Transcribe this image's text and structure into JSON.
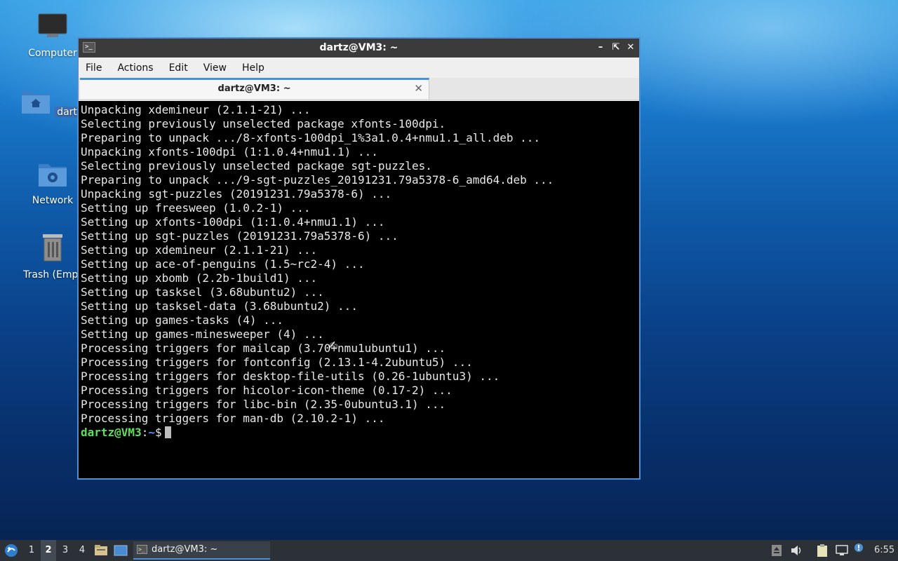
{
  "desktop": {
    "icons": [
      {
        "label": "Computer"
      },
      {
        "label": "dartz"
      },
      {
        "label": "Network"
      },
      {
        "label": "Trash (Empt"
      }
    ]
  },
  "window": {
    "title": "dartz@VM3: ~",
    "menu": [
      "File",
      "Actions",
      "Edit",
      "View",
      "Help"
    ],
    "tab_title": "dartz@VM3: ~",
    "terminal_lines": [
      "Unpacking xdemineur (2.1.1-21) ...",
      "Selecting previously unselected package xfonts-100dpi.",
      "Preparing to unpack .../8-xfonts-100dpi_1%3a1.0.4+nmu1.1_all.deb ...",
      "Unpacking xfonts-100dpi (1:1.0.4+nmu1.1) ...",
      "Selecting previously unselected package sgt-puzzles.",
      "Preparing to unpack .../9-sgt-puzzles_20191231.79a5378-6_amd64.deb ...",
      "Unpacking sgt-puzzles (20191231.79a5378-6) ...",
      "Setting up freesweep (1.0.2-1) ...",
      "Setting up xfonts-100dpi (1:1.0.4+nmu1.1) ...",
      "Setting up sgt-puzzles (20191231.79a5378-6) ...",
      "Setting up xdemineur (2.1.1-21) ...",
      "Setting up ace-of-penguins (1.5~rc2-4) ...",
      "Setting up xbomb (2.2b-1build1) ...",
      "Setting up tasksel (3.68ubuntu2) ...",
      "Setting up tasksel-data (3.68ubuntu2) ...",
      "Setting up games-tasks (4) ...",
      "Setting up games-minesweeper (4) ...",
      "Processing triggers for mailcap (3.70+nmu1ubuntu1) ...",
      "Processing triggers for fontconfig (2.13.1-4.2ubuntu5) ...",
      "Processing triggers for desktop-file-utils (0.26-1ubuntu3) ...",
      "Processing triggers for hicolor-icon-theme (0.17-2) ...",
      "Processing triggers for libc-bin (2.35-0ubuntu3.1) ...",
      "Processing triggers for man-db (2.10.2-1) ..."
    ],
    "prompt": {
      "user_host": "dartz@VM3",
      "sep": ":",
      "path": "~",
      "symbol": "$"
    }
  },
  "taskbar": {
    "workspaces": [
      "1",
      "2",
      "3",
      "4"
    ],
    "active_workspace": "2",
    "task_label": "dartz@VM3: ~",
    "clock": "6:55"
  }
}
